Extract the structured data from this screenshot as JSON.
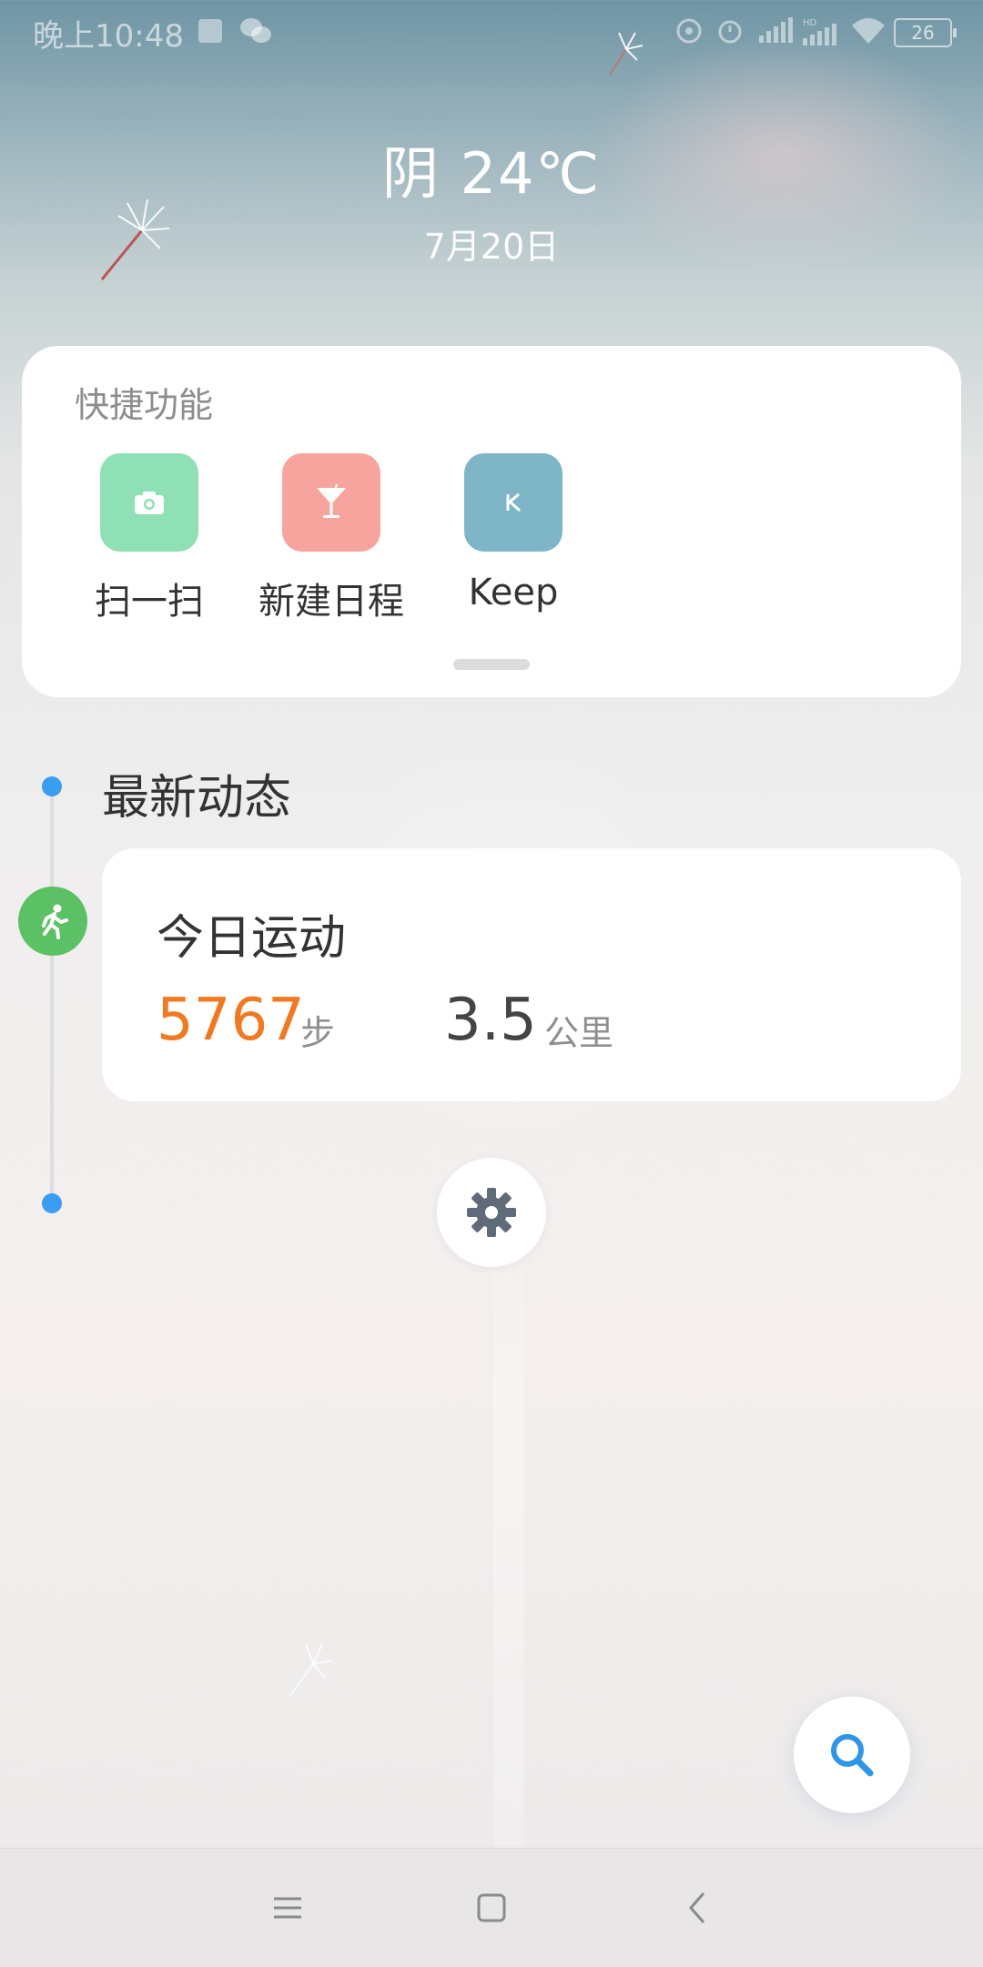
{
  "status_bar": {
    "time": "晚上10:48",
    "battery": "26",
    "icons": [
      "notification-square-icon",
      "wechat-icon",
      "hotspot-icon",
      "alarm-icon",
      "signal-icon",
      "hd-signal-icon",
      "wifi-icon",
      "battery-icon"
    ]
  },
  "weather": {
    "condition_temp": "阴  24℃",
    "date": "7月20日"
  },
  "quick_functions": {
    "title": "快捷功能",
    "items": [
      {
        "label": "扫一扫",
        "icon": "camera-icon",
        "color": "#8fe0b5"
      },
      {
        "label": "新建日程",
        "icon": "cocktail-icon",
        "color": "#f8a49e"
      },
      {
        "label": "Keep",
        "icon": "keep-k-icon",
        "color": "#7fb6c7"
      }
    ]
  },
  "feed": {
    "title": "最新动态",
    "sport_card": {
      "title": "今日运动",
      "steps_value": "5767",
      "steps_unit": "步",
      "distance_value": "3.5",
      "distance_unit": "公里",
      "steps_color": "#f07a22"
    },
    "timeline_color": "#3a9df0",
    "badge_color": "#5cc064"
  },
  "nav": {
    "buttons": [
      "menu-icon",
      "home-icon",
      "back-icon"
    ]
  }
}
